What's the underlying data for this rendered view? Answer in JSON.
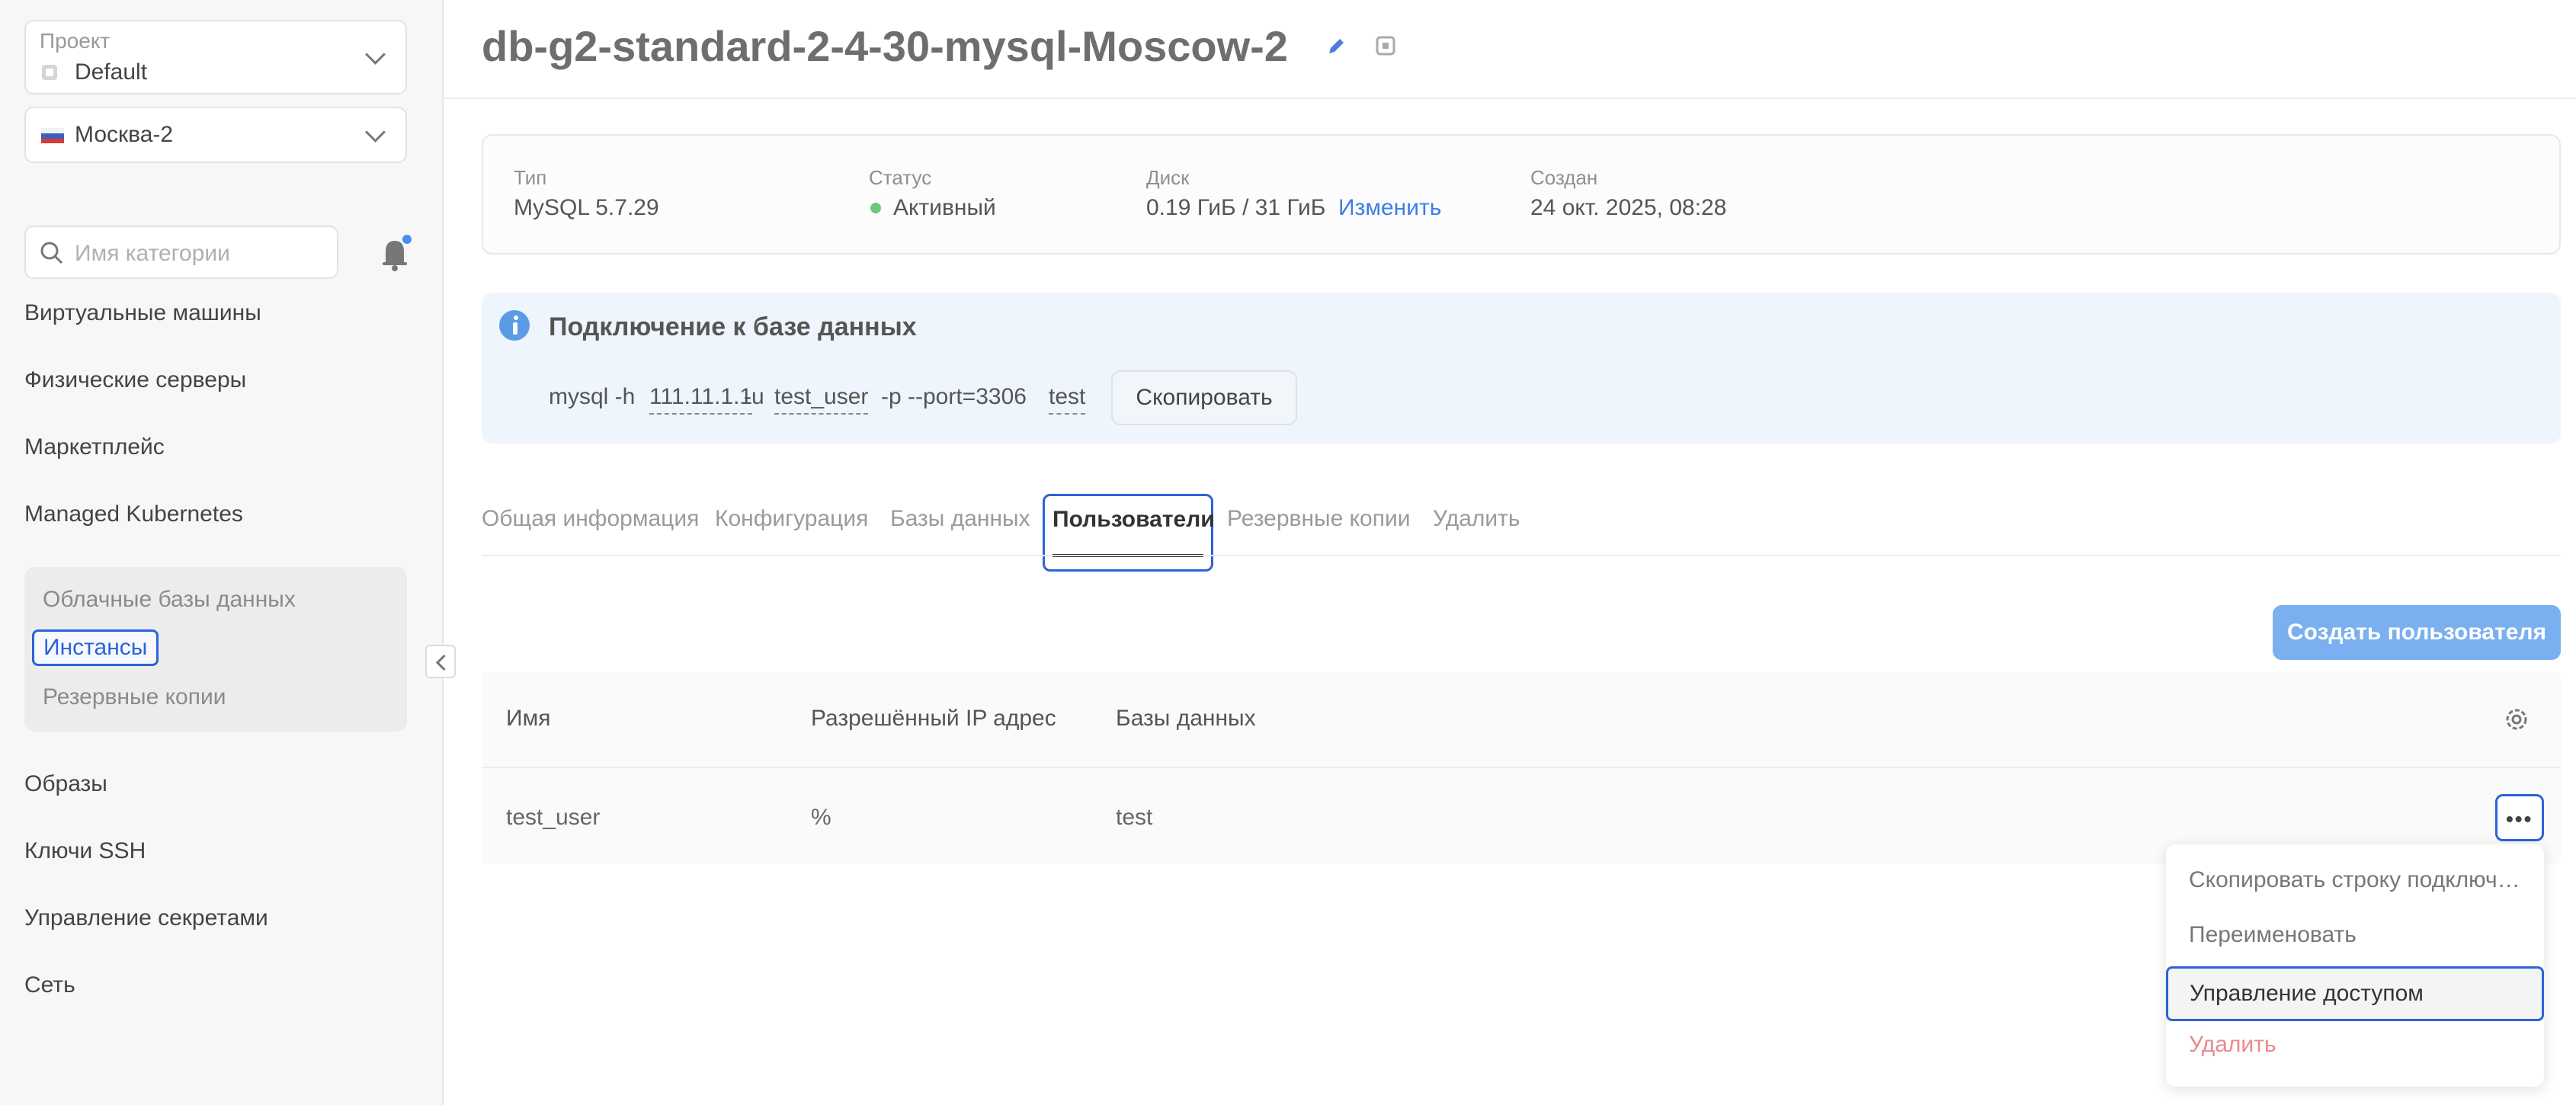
{
  "sidebar": {
    "project": {
      "label": "Проект",
      "value": "Default"
    },
    "region": {
      "value": "Москва-2"
    },
    "search": {
      "placeholder": "Имя категории"
    },
    "items": [
      {
        "label": "Виртуальные машины"
      },
      {
        "label": "Физические серверы"
      },
      {
        "label": "Маркетплейс"
      },
      {
        "label": "Managed Kubernetes"
      },
      {
        "label": "Образы"
      },
      {
        "label": "Ключи SSH"
      },
      {
        "label": "Управление секретами"
      },
      {
        "label": "Сеть"
      }
    ],
    "subgroup": {
      "title": "Облачные базы данных",
      "items": [
        {
          "label": "Инстансы"
        },
        {
          "label": "Резервные копии"
        }
      ]
    }
  },
  "header": {
    "title": "db-g2-standard-2-4-30-mysql-Moscow-2"
  },
  "info": {
    "type": {
      "label": "Тип",
      "value": "MySQL 5.7.29"
    },
    "status": {
      "label": "Статус",
      "value": "Активный"
    },
    "disk": {
      "label": "Диск",
      "value": "0.19 ГиБ / 31 ГиБ",
      "action": "Изменить"
    },
    "created": {
      "label": "Создан",
      "value": "24 окт. 2025, 08:28"
    }
  },
  "connection": {
    "title": "Подключение к базе данных",
    "cmd_prefix": "mysql -h",
    "host": "111.11.1.1",
    "user_flag": "-u",
    "user": "test_user",
    "port_part": "-p --port=3306",
    "db": "test",
    "copy_label": "Скопировать"
  },
  "tabs": [
    {
      "label": "Общая информация"
    },
    {
      "label": "Конфигурация"
    },
    {
      "label": "Базы данных"
    },
    {
      "label": "Пользователи"
    },
    {
      "label": "Резервные копии"
    },
    {
      "label": "Удалить"
    }
  ],
  "create_user_label": "Создать пользователя",
  "table": {
    "columns": [
      "Имя",
      "Разрешённый IP адрес",
      "Базы данных"
    ],
    "rows": [
      {
        "name": "test_user",
        "ip": "%",
        "db": "test"
      }
    ]
  },
  "menu": {
    "items": [
      {
        "label": "Скопировать строку подключения"
      },
      {
        "label": "Переименовать"
      },
      {
        "label": "Управление доступом"
      },
      {
        "label": "Удалить"
      }
    ]
  },
  "colors": {
    "accent": "#2b63d9",
    "primary_button": "#7ab0f0",
    "status_active": "#6cc87a",
    "danger": "#e88a8a"
  }
}
